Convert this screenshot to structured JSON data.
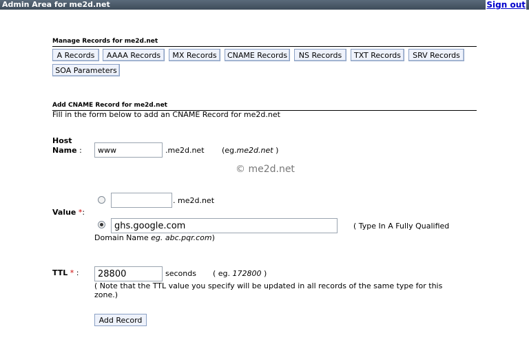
{
  "header": {
    "title": "Admin Area for me2d.net",
    "signout": "Sign out"
  },
  "manage": {
    "heading": "Manage Records for me2d.net",
    "tabs": [
      "A Records",
      "AAAA Records",
      "MX Records",
      "CNAME Records",
      "NS Records",
      "TXT Records",
      "SRV Records",
      "SOA Parameters"
    ]
  },
  "add": {
    "heading": "Add CNAME Record for me2d.net",
    "instructions": "Fill in the form below to add an CNAME Record for me2d.net"
  },
  "host": {
    "label_line1": "Host",
    "label_line2": "Name",
    "colon": ":",
    "value": "www",
    "suffix": ".me2d.net",
    "example_prefix": "(eg.",
    "example_value": "me2d.net",
    "example_suffix": ")"
  },
  "watermark": "© me2d.net",
  "value_field": {
    "label": "Value",
    "req": "*",
    "colon": ":",
    "option1_value": "",
    "option1_suffix": ". me2d.net",
    "option2_value": "ghs.google.com",
    "hint_line1": "( Type In A Fully Qualified",
    "hint_line2_prefix": "Domain Name",
    "hint_line2_example": "eg. abc.pqr.com",
    "hint_line2_suffix": ")"
  },
  "ttl": {
    "label": "TTL",
    "req": "*",
    "colon": ":",
    "value": "28800",
    "unit": "seconds",
    "example_prefix": "( eg.",
    "example_value": "172800",
    "example_suffix": ")",
    "note_line1": "( Note that the TTL value you specify will be updated in all records of the same type for this",
    "note_line2": "zone.)"
  },
  "submit": {
    "label": "Add Record"
  }
}
